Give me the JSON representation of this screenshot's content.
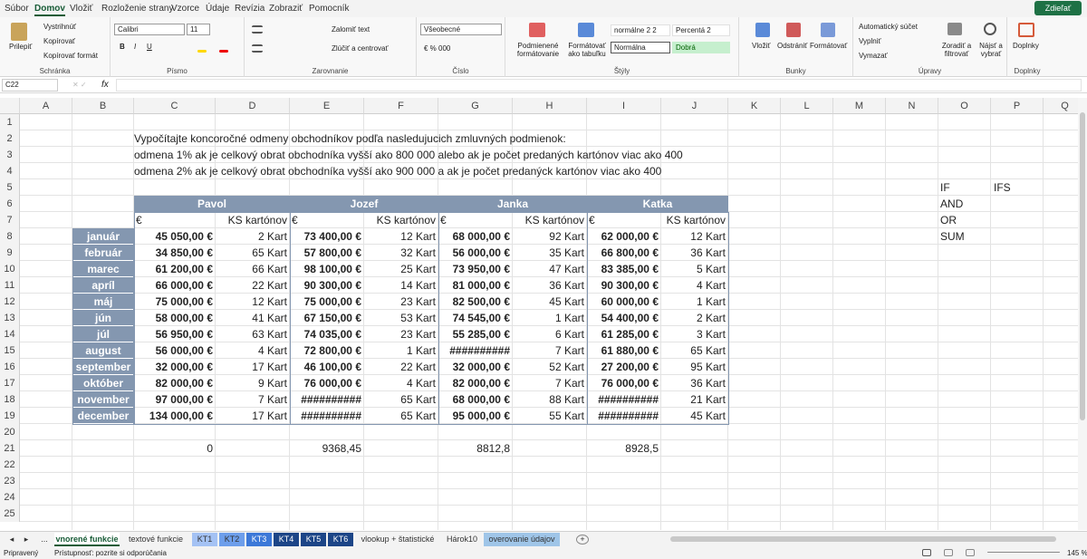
{
  "menu": {
    "tabs": [
      "Súbor",
      "Domov",
      "Vložiť",
      "Rozloženie strany",
      "Vzorce",
      "Údaje",
      "Revízia",
      "Zobraziť",
      "Pomocník"
    ],
    "active": "Domov",
    "share": "Zdieľať"
  },
  "ribbon": {
    "clipboard": {
      "label": "Schránka",
      "paste": "Prilepiť",
      "cut": "Vystrihnúť",
      "copy": "Kopírovať",
      "format_painter": "Kopírovať formát"
    },
    "font": {
      "label": "Písmo",
      "name": "Calibri",
      "size": "11",
      "bold": "B",
      "italic": "I",
      "underline": "U"
    },
    "alignment": {
      "label": "Zarovnanie",
      "wrap": "Zalomiť text",
      "merge": "Zlúčiť a centrovať"
    },
    "number": {
      "label": "Číslo",
      "format": "Všeobecné"
    },
    "styles": {
      "label": "Štýly",
      "conditional": "Podmienené formátovanie",
      "format_table": "Formátovať ako tabuľku",
      "s1": "normálne 2 2",
      "s2": "Percentá 2",
      "s3": "Normálna",
      "s4": "Dobrá"
    },
    "cells": {
      "label": "Bunky",
      "insert": "Vložiť",
      "delete": "Odstrániť",
      "format": "Formátovať"
    },
    "editing": {
      "label": "Úpravy",
      "autosum": "Automatický súčet",
      "fill": "Vyplniť",
      "clear": "Vymazať",
      "sort": "Zoradiť a filtrovať",
      "find": "Nájsť a vybrať"
    },
    "addins": {
      "label": "Doplnky",
      "btn": "Doplnky"
    }
  },
  "formula_bar": {
    "name_box": "C22",
    "fx": "fx",
    "value": ""
  },
  "columns": [
    "A",
    "B",
    "C",
    "D",
    "E",
    "F",
    "G",
    "H",
    "I",
    "J",
    "K",
    "L",
    "M",
    "N",
    "O",
    "P",
    "Q"
  ],
  "rows": [
    "1",
    "2",
    "3",
    "4",
    "5",
    "6",
    "7",
    "8",
    "9",
    "10",
    "11",
    "12",
    "13",
    "14",
    "15",
    "16",
    "17",
    "18",
    "19",
    "20",
    "21",
    "22",
    "23",
    "24",
    "25"
  ],
  "text": {
    "r2": "Vypočítajte koncoročné odmeny obchodníkov podľa nasledujucich zmluvných podmienok:",
    "r3": "odmena 1% ak je celkový obrat obchodníka vyšší ako 800 000 alebo ak je počet predaných kartónov viac ako 400",
    "r4": "odmena 2% ak je celkový obrat obchodníka vyšší ako 900 000 a ak je počet predanýck kartónov viac ako 400"
  },
  "functions": {
    "o5": "IF",
    "p5": "IFS",
    "o6": "AND",
    "o7": "OR",
    "o8": "SUM"
  },
  "table": {
    "names": [
      "Pavol",
      "Jozef",
      "Janka",
      "Katka"
    ],
    "sub_euro": "€",
    "sub_ks": "KS kartónov",
    "months": [
      "január",
      "február",
      "marec",
      "apríl",
      "máj",
      "jún",
      "júl",
      "august",
      "september",
      "október",
      "november",
      "december"
    ],
    "data": [
      [
        [
          "45 050,00 €",
          "2 Kart"
        ],
        [
          "73 400,00 €",
          "12 Kart"
        ],
        [
          "68 000,00 €",
          "92 Kart"
        ],
        [
          "62 000,00 €",
          "12 Kart"
        ]
      ],
      [
        [
          "34 850,00 €",
          "65 Kart"
        ],
        [
          "57 800,00 €",
          "32 Kart"
        ],
        [
          "56 000,00 €",
          "35 Kart"
        ],
        [
          "66 800,00 €",
          "36 Kart"
        ]
      ],
      [
        [
          "61 200,00 €",
          "66 Kart"
        ],
        [
          "98 100,00 €",
          "25 Kart"
        ],
        [
          "73 950,00 €",
          "47 Kart"
        ],
        [
          "83 385,00 €",
          "5 Kart"
        ]
      ],
      [
        [
          "66 000,00 €",
          "22 Kart"
        ],
        [
          "90 300,00 €",
          "14 Kart"
        ],
        [
          "81 000,00 €",
          "36 Kart"
        ],
        [
          "90 300,00 €",
          "4 Kart"
        ]
      ],
      [
        [
          "75 000,00 €",
          "12 Kart"
        ],
        [
          "75 000,00 €",
          "23 Kart"
        ],
        [
          "82 500,00 €",
          "45 Kart"
        ],
        [
          "60 000,00 €",
          "1 Kart"
        ]
      ],
      [
        [
          "58 000,00 €",
          "41 Kart"
        ],
        [
          "67 150,00 €",
          "53 Kart"
        ],
        [
          "74 545,00 €",
          "1 Kart"
        ],
        [
          "54 400,00 €",
          "2 Kart"
        ]
      ],
      [
        [
          "56 950,00 €",
          "63 Kart"
        ],
        [
          "74 035,00 €",
          "23 Kart"
        ],
        [
          "55 285,00 €",
          "6 Kart"
        ],
        [
          "61 285,00 €",
          "3 Kart"
        ]
      ],
      [
        [
          "56 000,00 €",
          "4 Kart"
        ],
        [
          "72 800,00 €",
          "1 Kart"
        ],
        [
          "##########",
          "7 Kart"
        ],
        [
          "61 880,00 €",
          "65 Kart"
        ]
      ],
      [
        [
          "32 000,00 €",
          "17 Kart"
        ],
        [
          "46 100,00 €",
          "22 Kart"
        ],
        [
          "32 000,00 €",
          "52 Kart"
        ],
        [
          "27 200,00 €",
          "95 Kart"
        ]
      ],
      [
        [
          "82 000,00 €",
          "9 Kart"
        ],
        [
          "76 000,00 €",
          "4 Kart"
        ],
        [
          "82 000,00 €",
          "7 Kart"
        ],
        [
          "76 000,00 €",
          "36 Kart"
        ]
      ],
      [
        [
          "97 000,00 €",
          "7 Kart"
        ],
        [
          "##########",
          "65 Kart"
        ],
        [
          "68 000,00 €",
          "88 Kart"
        ],
        [
          "##########",
          "21 Kart"
        ]
      ],
      [
        [
          "134 000,00 €",
          "17 Kart"
        ],
        [
          "##########",
          "65 Kart"
        ],
        [
          "95 000,00 €",
          "55 Kart"
        ],
        [
          "##########",
          "45 Kart"
        ]
      ]
    ],
    "results": [
      "0",
      "9368,45",
      "8812,8",
      "8928,5"
    ]
  },
  "sheet_tabs": [
    "vnorené funkcie",
    "textové funkcie",
    "KT1",
    "KT2",
    "KT3",
    "KT4",
    "KT5",
    "KT6",
    "vlookup + štatistické",
    "Hárok10",
    "overovanie údajov"
  ],
  "sheet_tabs_active": "vnorené funkcie",
  "sheet_tabs_more": "...",
  "status": {
    "ready": "Pripravený",
    "accessibility": "Prístupnosť: pozrite si odporúčania",
    "zoom": "145 %"
  }
}
